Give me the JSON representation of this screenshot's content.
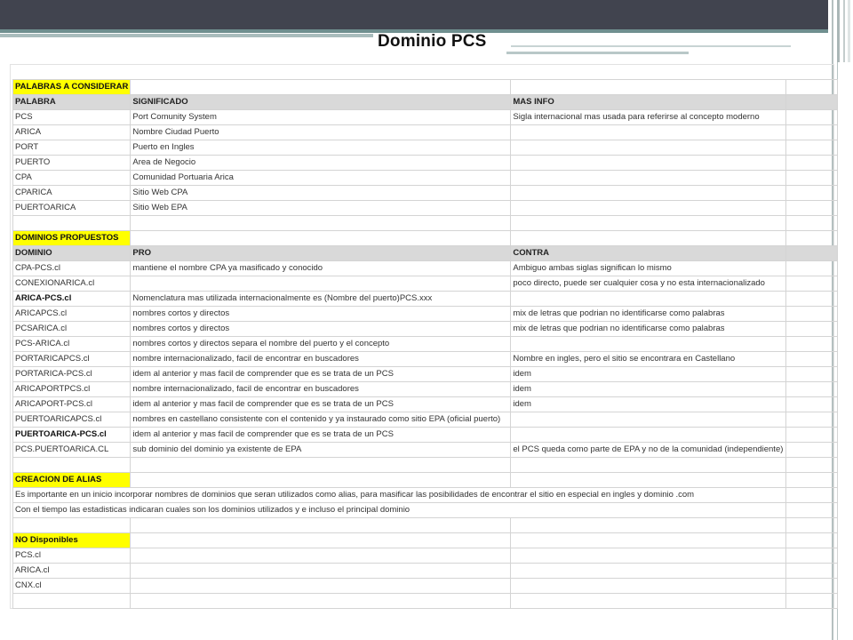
{
  "title": "Dominio PCS",
  "section1": {
    "label": "PALABRAS A CONSIDERAR",
    "headers": [
      "PALABRA",
      "SIGNIFICADO",
      "MAS INFO"
    ],
    "rows": [
      [
        "PCS",
        "Port Comunity System",
        "Sigla internacional mas usada para referirse al concepto moderno"
      ],
      [
        "ARICA",
        "Nombre Ciudad Puerto",
        ""
      ],
      [
        "PORT",
        "Puerto en Ingles",
        ""
      ],
      [
        "PUERTO",
        "Area de Negocio",
        ""
      ],
      [
        "CPA",
        "Comunidad Portuaria Arica",
        ""
      ],
      [
        "CPARICA",
        "Sitio Web CPA",
        ""
      ],
      [
        "PUERTOARICA",
        "Sitio Web EPA",
        ""
      ]
    ]
  },
  "section2": {
    "label": "DOMINIOS PROPUESTOS",
    "headers": [
      "DOMINIO",
      "PRO",
      "CONTRA"
    ],
    "rows": [
      [
        "CPA-PCS.cl",
        "mantiene el nombre CPA ya masificado y conocido",
        "Ambiguo ambas siglas significan lo mismo"
      ],
      [
        "CONEXIONARICA.cl",
        "",
        "poco directo, puede ser cualquier cosa y no esta internacionalizado"
      ],
      [
        "ARICA-PCS.cl",
        "Nomenclatura mas utilizada internacionalmente es (Nombre del puerto)PCS.xxx",
        ""
      ],
      [
        "ARICAPCS.cl",
        "nombres cortos y directos",
        "mix de letras que podrian no identificarse como palabras"
      ],
      [
        "PCSARICA.cl",
        "nombres cortos y directos",
        "mix de letras que podrian no identificarse como palabras"
      ],
      [
        "PCS-ARICA.cl",
        "nombres cortos y directos separa el nombre del puerto y el concepto",
        ""
      ],
      [
        "PORTARICAPCS.cl",
        "nombre internacionalizado, facil de encontrar en buscadores",
        "Nombre en ingles, pero el sitio se encontrara en Castellano"
      ],
      [
        "PORTARICA-PCS.cl",
        "idem al anterior y mas facil de comprender que es se trata de un PCS",
        "idem"
      ],
      [
        "ARICAPORTPCS.cl",
        "nombre internacionalizado, facil de encontrar en buscadores",
        "idem"
      ],
      [
        "ARICAPORT-PCS.cl",
        "idem al anterior y mas facil de comprender que es se trata de un PCS",
        "idem"
      ],
      [
        "PUERTOARICAPCS.cl",
        "nombres en castellano consistente con el contenido y ya instaurado como sitio EPA (oficial puerto)",
        ""
      ],
      [
        "PUERTOARICA-PCS.cl",
        "idem al anterior y mas facil de comprender que es se trata de un PCS",
        ""
      ],
      [
        "PCS.PUERTOARICA.CL",
        "sub dominio del dominio ya existente de EPA",
        "el PCS queda como parte de EPA y no de la comunidad (independiente)"
      ]
    ]
  },
  "section3": {
    "label": "CREACION DE ALIAS",
    "lines": [
      "Es importante en un inicio incorporar nombres de dominios que seran utilizados como alias, para masificar las posibilidades de encontrar el sitio en especial en ingles y dominio .com",
      "Con el tiempo las estadisticas indicaran cuales son los dominios utilizados y e incluso el principal dominio"
    ]
  },
  "section4": {
    "label": "NO Disponibles",
    "rows": [
      "PCS.cl",
      "ARICA.cl",
      "CNX.cl"
    ]
  }
}
